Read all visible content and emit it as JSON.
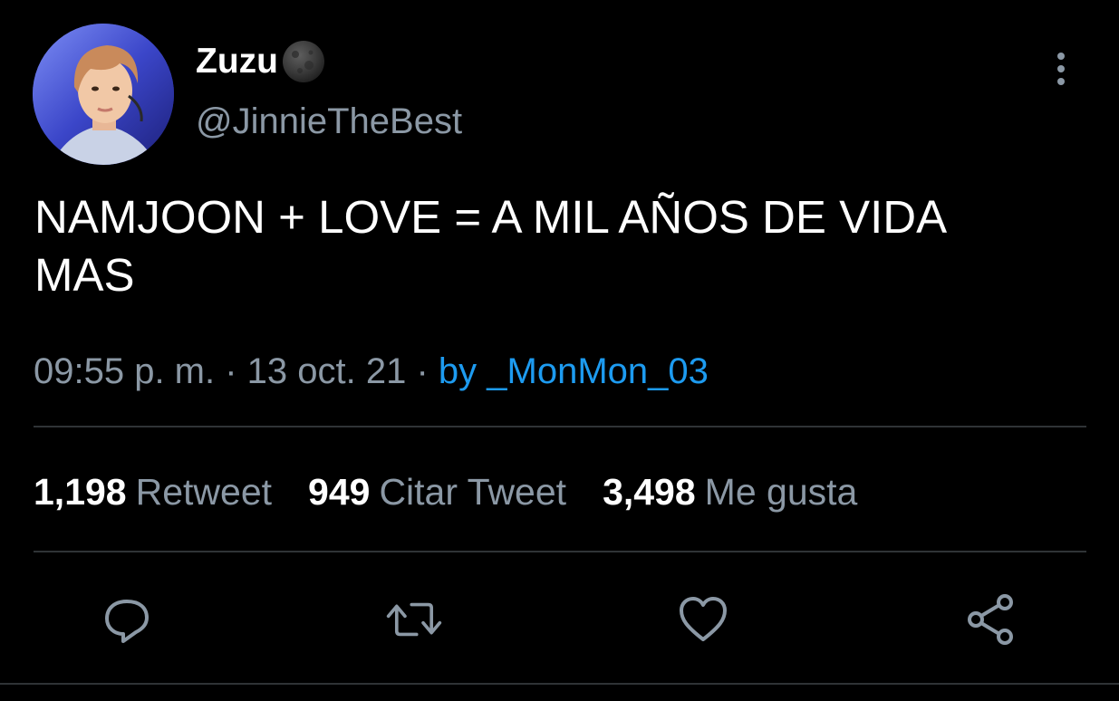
{
  "tweet": {
    "display_name": "Zuzu",
    "name_emoji": "new-moon-emoji",
    "handle": "@JinnieTheBest",
    "text_line1": "NAMJOON + LOVE = A MIL AÑOS DE VIDA",
    "text_line2": "MAS",
    "time": "09:55 p. m.",
    "separator1": " · ",
    "date": "13 oct. 21",
    "separator2": " · ",
    "source": "by _MonMon_03"
  },
  "stats": [
    {
      "count": "1,198",
      "label": "Retweet"
    },
    {
      "count": "949",
      "label": "Citar Tweet"
    },
    {
      "count": "3,498",
      "label": "Me gusta"
    }
  ],
  "actions": {
    "reply_icon": "reply-icon",
    "retweet_icon": "retweet-icon",
    "like_icon": "heart-icon",
    "share_icon": "share-icon"
  },
  "colors": {
    "background": "#000000",
    "primary_text": "#ffffff",
    "secondary_text": "#8b98a5",
    "link": "#1d9bf0",
    "divider": "#2f3336"
  }
}
